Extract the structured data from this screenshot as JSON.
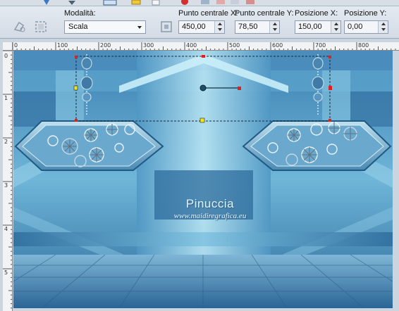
{
  "toolbar": {
    "mode_label": "Modalità:",
    "mode_value": "Scala",
    "center_x_label": "Punto centrale X:",
    "center_x_value": "450,00",
    "center_y_label": "Punto centrale Y:",
    "center_y_value": "78,50",
    "pos_x_label": "Posizione X:",
    "pos_x_value": "150,00",
    "pos_y_label": "Posizione Y:",
    "pos_y_value": "0,00"
  },
  "ruler": {
    "top_labels": [
      "0",
      "100",
      "200",
      "300",
      "400",
      "500",
      "600",
      "700",
      "800"
    ],
    "left_labels": [
      "0",
      "1",
      "2",
      "3",
      "4",
      "5"
    ]
  },
  "image": {
    "watermark_title": "Pinuccia",
    "watermark_url": "www.maidiregrafica.eu"
  },
  "colors": {
    "toolbar_bg": "#dbe2ea",
    "canvas_deep": "#2f6f9e",
    "canvas_light": "#a8dcef",
    "handle_red": "#e02020",
    "handle_yellow": "#f3e31a"
  }
}
